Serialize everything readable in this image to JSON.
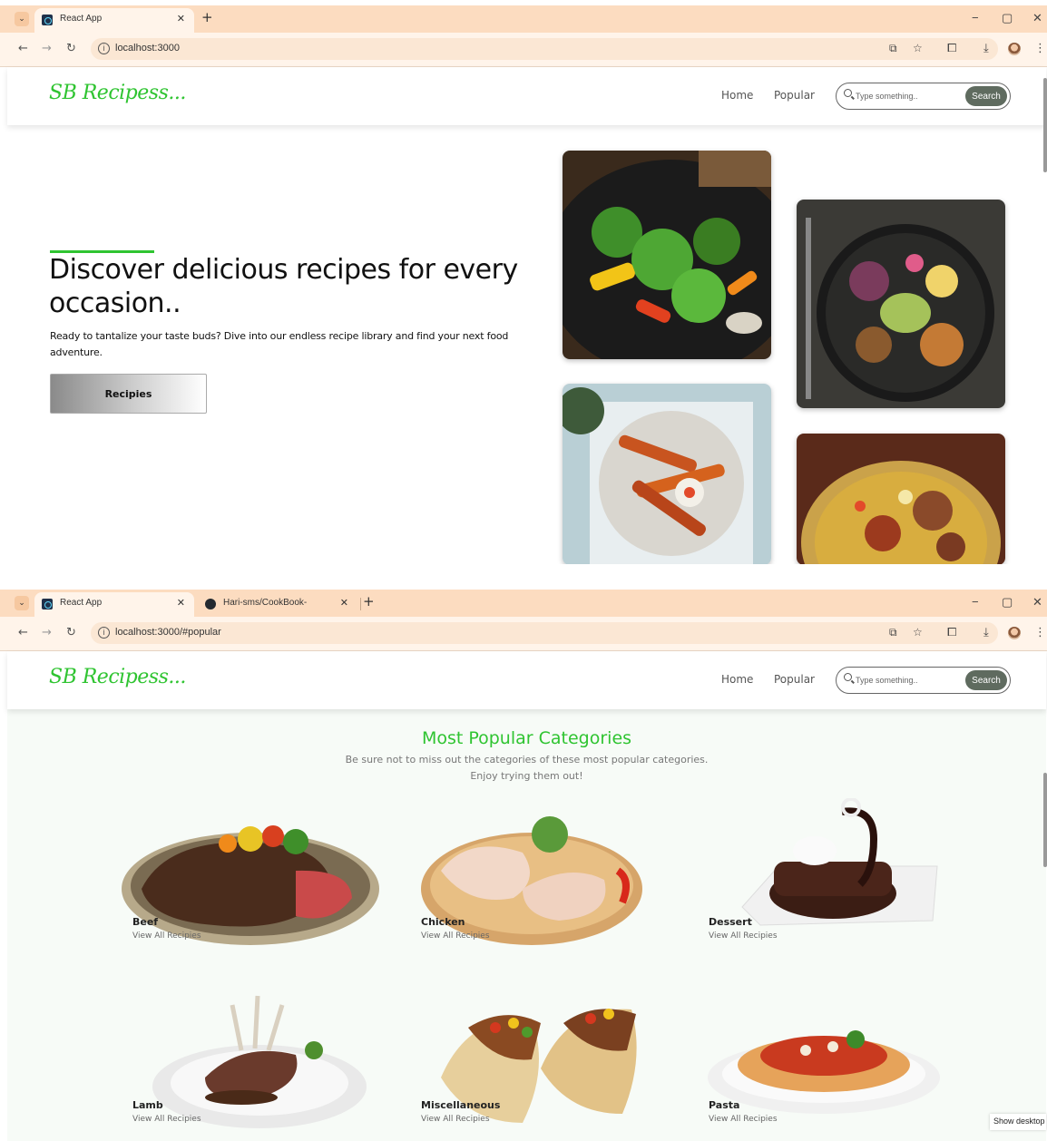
{
  "browser1": {
    "tabs": [
      {
        "label": "React App"
      }
    ],
    "url": "localhost:3000"
  },
  "browser2": {
    "tabs": [
      {
        "label": "React App"
      },
      {
        "label": "Hari-sms/CookBook-"
      }
    ],
    "url": "localhost:3000/#popular"
  },
  "navbar": {
    "logo": "SB Recipess...",
    "links": [
      "Home",
      "Popular"
    ],
    "search_placeholder": "Type something..",
    "search_button": "Search"
  },
  "hero": {
    "title": "Discover delicious recipes for every occasion..",
    "subtitle": "Ready to tantalize your taste buds? Dive into our endless recipe library and find your next food adventure.",
    "button": "Recipies"
  },
  "popular": {
    "title": "Most Popular Categories",
    "subtitle_line1": "Be sure not to miss out the categories of these most popular categories.",
    "subtitle_line2": "Enjoy trying them out!",
    "categories": [
      {
        "name": "Beef",
        "link": "View All Recipies"
      },
      {
        "name": "Chicken",
        "link": "View All Recipies"
      },
      {
        "name": "Dessert",
        "link": "View All Recipies"
      },
      {
        "name": "Lamb",
        "link": "View All Recipies"
      },
      {
        "name": "Miscellaneous",
        "link": "View All Recipies"
      },
      {
        "name": "Pasta",
        "link": "View All Recipies"
      }
    ]
  },
  "taskbar": {
    "show_desktop": "Show desktop"
  },
  "colors": {
    "accent": "#2fc431",
    "chrome": "#fcdcc0",
    "search_button": "#5f6b5f"
  }
}
